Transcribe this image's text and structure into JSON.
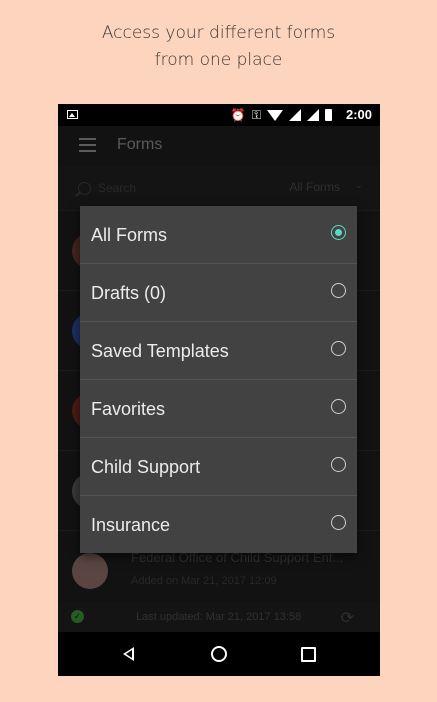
{
  "caption": {
    "line1": "Access your different forms",
    "line2": "from one place"
  },
  "status_bar": {
    "time": "2:00",
    "icons": [
      "image-icon",
      "alarm-icon",
      "key-icon",
      "wifi-icon",
      "signal-icon",
      "battery-icon"
    ]
  },
  "app_bar": {
    "title": "Forms"
  },
  "search": {
    "placeholder": "Search",
    "filter_value": "All Forms"
  },
  "list": {
    "rows": [
      {
        "title": "",
        "subtitle": "",
        "avatar_color": "#6b3b30"
      },
      {
        "title": "",
        "subtitle": "",
        "avatar_color": "#2a4c9a"
      },
      {
        "title": "",
        "subtitle": "",
        "avatar_color": "#7a2a20"
      },
      {
        "title": "",
        "subtitle": "",
        "avatar_color": "#5a5a5a"
      },
      {
        "title": "Federal Office of Child Support Enf...",
        "subtitle": "Added on Mar 21, 2017 12:09",
        "avatar_color": "#8a6a66"
      }
    ]
  },
  "footer": {
    "last_updated": "Last updated: Mar 21, 2017 13:58"
  },
  "dropdown": {
    "options": [
      {
        "label": "All Forms",
        "selected": true
      },
      {
        "label": "Drafts (0)",
        "selected": false
      },
      {
        "label": "Saved Templates",
        "selected": false
      },
      {
        "label": "Favorites",
        "selected": false
      },
      {
        "label": "Child Support",
        "selected": false
      },
      {
        "label": "Insurance",
        "selected": false
      }
    ]
  },
  "colors": {
    "background": "#fdd5bf",
    "accent": "#5fd6c2",
    "menu": "#424242"
  }
}
